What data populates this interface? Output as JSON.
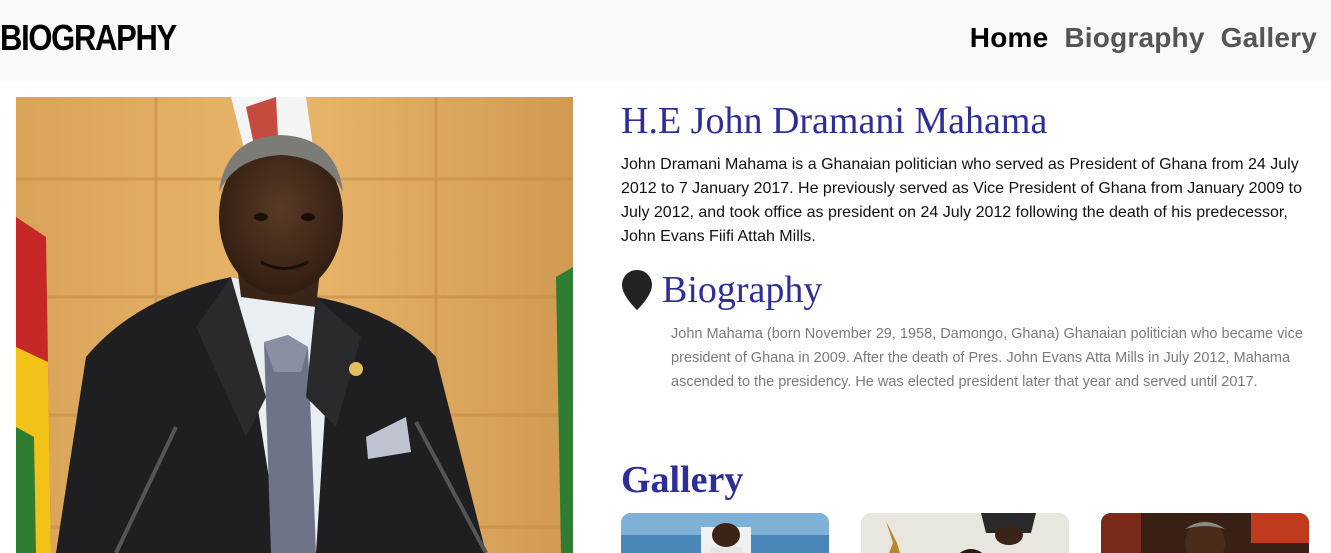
{
  "navbar": {
    "brand": "BIOGRAPHY",
    "links": [
      {
        "label": "Home",
        "active": true
      },
      {
        "label": "Biography",
        "active": false
      },
      {
        "label": "Gallery",
        "active": false
      }
    ]
  },
  "main": {
    "title": "H.E John Dramani Mahama",
    "intro": "John Dramani Mahama is a Ghanaian politician who served as President of Ghana from 24 July 2012 to 7 January 2017. He previously served as Vice President of Ghana from January 2009 to July 2012, and took office as president on 24 July 2012 following the death of his predecessor, John Evans Fiifi Attah Mills.",
    "biography": {
      "icon": "map-pin-icon",
      "title": "Biography",
      "text": "John Mahama (born November 29, 1958, Damongo, Ghana) Ghanaian politician who became vice president of Ghana in 2009. After the death of Pres. John Evans Atta Mills in July 2012, Mahama ascended to the presidency. He was elected president later that year and served until 2017."
    },
    "gallery": {
      "title": "Gallery"
    }
  },
  "colors": {
    "heading": "#2e2e9a",
    "navbar_bg": "#f8f9fa"
  }
}
